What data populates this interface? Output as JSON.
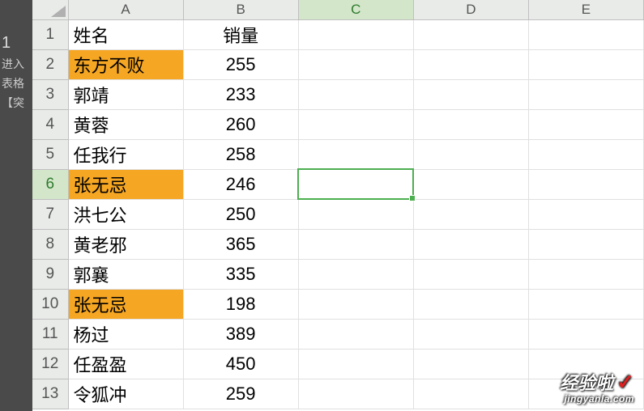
{
  "sidebar": {
    "big": "1",
    "items": [
      "进入",
      "表格",
      "【突"
    ]
  },
  "columns": [
    "A",
    "B",
    "C",
    "D",
    "E"
  ],
  "selected_col_index": 2,
  "selected_row_index": 5,
  "active_cell": {
    "row": 5,
    "col": 2
  },
  "header_row": {
    "A": "姓名",
    "B": "销量"
  },
  "rows": [
    {
      "num": 1,
      "A": "姓名",
      "B": "销量",
      "hl": false,
      "header": true
    },
    {
      "num": 2,
      "A": "东方不败",
      "B": "255",
      "hl": true
    },
    {
      "num": 3,
      "A": "郭靖",
      "B": "233",
      "hl": false
    },
    {
      "num": 4,
      "A": "黄蓉",
      "B": "260",
      "hl": false
    },
    {
      "num": 5,
      "A": "任我行",
      "B": "258",
      "hl": false
    },
    {
      "num": 6,
      "A": "张无忌",
      "B": "246",
      "hl": true
    },
    {
      "num": 7,
      "A": "洪七公",
      "B": "250",
      "hl": false
    },
    {
      "num": 8,
      "A": "黄老邪",
      "B": "365",
      "hl": false
    },
    {
      "num": 9,
      "A": "郭襄",
      "B": "335",
      "hl": false
    },
    {
      "num": 10,
      "A": "张无忌",
      "B": "198",
      "hl": true
    },
    {
      "num": 11,
      "A": "杨过",
      "B": "389",
      "hl": false
    },
    {
      "num": 12,
      "A": "任盈盈",
      "B": "450",
      "hl": false
    },
    {
      "num": 13,
      "A": "令狐冲",
      "B": "259",
      "hl": false
    }
  ],
  "chart_data": {
    "type": "table",
    "columns": [
      "姓名",
      "销量"
    ],
    "rows": [
      [
        "东方不败",
        255
      ],
      [
        "郭靖",
        233
      ],
      [
        "黄蓉",
        260
      ],
      [
        "任我行",
        258
      ],
      [
        "张无忌",
        246
      ],
      [
        "洪七公",
        250
      ],
      [
        "黄老邪",
        365
      ],
      [
        "郭襄",
        335
      ],
      [
        "张无忌",
        198
      ],
      [
        "杨过",
        389
      ],
      [
        "任盈盈",
        450
      ],
      [
        "令狐冲",
        259
      ]
    ]
  },
  "watermark": {
    "main": "经验啦",
    "check": "✓",
    "sub": "jingyanla.com"
  }
}
